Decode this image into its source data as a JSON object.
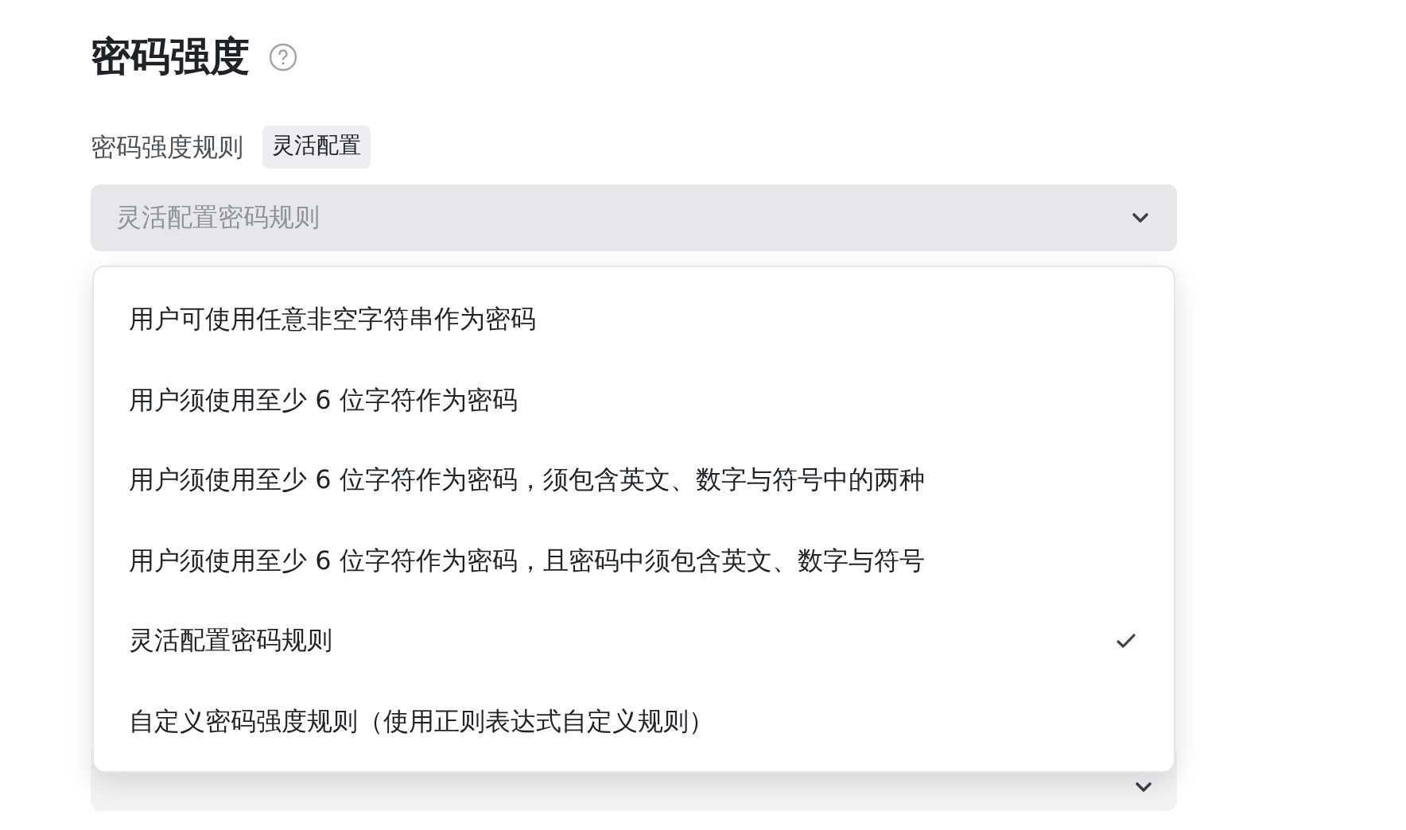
{
  "section": {
    "title": "密码强度"
  },
  "field": {
    "label": "密码强度规则",
    "tag": "灵活配置",
    "placeholder": "灵活配置密码规则",
    "expanded": true
  },
  "options": [
    {
      "label": "用户可使用任意非空字符串作为密码",
      "selected": false
    },
    {
      "label": "用户须使用至少 6 位字符作为密码",
      "selected": false
    },
    {
      "label": "用户须使用至少 6 位字符作为密码，须包含英文、数字与符号中的两种",
      "selected": false
    },
    {
      "label": "用户须使用至少 6 位字符作为密码，且密码中须包含英文、数字与符号",
      "selected": false
    },
    {
      "label": "灵活配置密码规则",
      "selected": true
    },
    {
      "label": "自定义密码强度规则（使用正则表达式自定义规则）",
      "selected": false
    }
  ]
}
